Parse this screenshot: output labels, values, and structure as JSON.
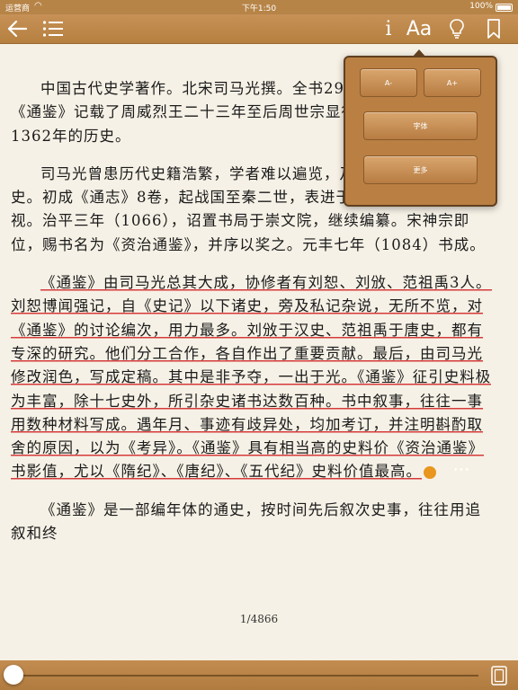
{
  "status_bar": {
    "carrier": "运营商",
    "time": "下午1:50",
    "battery_text": "100%"
  },
  "toolbar": {
    "back_icon": "arrow-left-icon",
    "toc_icon": "list-icon",
    "info_label": "i",
    "font_label": "Aa",
    "bulb_icon": "lightbulb-icon",
    "bookmark_icon": "bookmark-icon"
  },
  "font_popover": {
    "decrease_label": "A-",
    "increase_label": "A+",
    "font_label": "字体",
    "more_label": "更多"
  },
  "content": {
    "p1": "中国古代史学著作。北宋司马光撰。全书294卷，《考异》30卷。《通鉴》记载了周威烈王二十三年至后周世宗显德六年（959）共1362年的历史。",
    "p2": "司马光曾患历代史籍浩繁，学者难以遍览，乃删繁撮要，撰年史。初成《通志》8卷，起战国至秦二世，表进于朝，得到英宗的重视。治平三年（1066），诏置书局于崇文院，继续编纂。宋神宗即位，赐书名为《资治通鉴》，并序以奖之。元丰七年（1084）书成。",
    "p3": "《通鉴》由司马光总其大成，协修者有刘恕、刘攽、范祖禹3人。刘恕博闻强记，自《史记》以下诸史，旁及私记杂说，无所不览，对《通鉴》的讨论编次，用力最多。刘攽于汉史、范祖禹于唐史，都有专深的研究。他们分工合作，各自作出了重要贡献。最后，由司马光修改润色，写成定稿。其中是非予夺，一出于光。《通鉴》征引史料极为丰富，除十七史外，所引杂史诸书达数百种。书中叙事，往往一事用数种材料写成。遇年月、事迹有歧异处，均加考订，并注明斟酌取舍的原因，以为《考异》。《通鉴》具有相当高的史料价《资治通鉴》书影值，尤以《隋纪》、《唐纪》、《五代纪》史料价值最高。",
    "p4": "《通鉴》是一部编年体的通史，按时间先后叙次史事，往往用追叙和终"
  },
  "page_number": "1/4866",
  "progress": 0.0,
  "colors": {
    "toolbar": "#b98444",
    "paper": "#f6f1e6",
    "highlight_line": "#d53a3a",
    "note_badge": "#e8961e"
  }
}
